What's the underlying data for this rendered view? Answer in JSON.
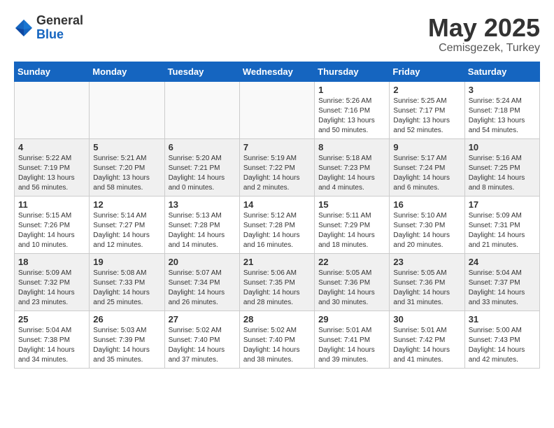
{
  "header": {
    "logo_general": "General",
    "logo_blue": "Blue",
    "month_title": "May 2025",
    "location": "Cemisgezek, Turkey"
  },
  "days_of_week": [
    "Sunday",
    "Monday",
    "Tuesday",
    "Wednesday",
    "Thursday",
    "Friday",
    "Saturday"
  ],
  "weeks": [
    [
      {
        "day": "",
        "info": ""
      },
      {
        "day": "",
        "info": ""
      },
      {
        "day": "",
        "info": ""
      },
      {
        "day": "",
        "info": ""
      },
      {
        "day": "1",
        "info": "Sunrise: 5:26 AM\nSunset: 7:16 PM\nDaylight: 13 hours\nand 50 minutes."
      },
      {
        "day": "2",
        "info": "Sunrise: 5:25 AM\nSunset: 7:17 PM\nDaylight: 13 hours\nand 52 minutes."
      },
      {
        "day": "3",
        "info": "Sunrise: 5:24 AM\nSunset: 7:18 PM\nDaylight: 13 hours\nand 54 minutes."
      }
    ],
    [
      {
        "day": "4",
        "info": "Sunrise: 5:22 AM\nSunset: 7:19 PM\nDaylight: 13 hours\nand 56 minutes."
      },
      {
        "day": "5",
        "info": "Sunrise: 5:21 AM\nSunset: 7:20 PM\nDaylight: 13 hours\nand 58 minutes."
      },
      {
        "day": "6",
        "info": "Sunrise: 5:20 AM\nSunset: 7:21 PM\nDaylight: 14 hours\nand 0 minutes."
      },
      {
        "day": "7",
        "info": "Sunrise: 5:19 AM\nSunset: 7:22 PM\nDaylight: 14 hours\nand 2 minutes."
      },
      {
        "day": "8",
        "info": "Sunrise: 5:18 AM\nSunset: 7:23 PM\nDaylight: 14 hours\nand 4 minutes."
      },
      {
        "day": "9",
        "info": "Sunrise: 5:17 AM\nSunset: 7:24 PM\nDaylight: 14 hours\nand 6 minutes."
      },
      {
        "day": "10",
        "info": "Sunrise: 5:16 AM\nSunset: 7:25 PM\nDaylight: 14 hours\nand 8 minutes."
      }
    ],
    [
      {
        "day": "11",
        "info": "Sunrise: 5:15 AM\nSunset: 7:26 PM\nDaylight: 14 hours\nand 10 minutes."
      },
      {
        "day": "12",
        "info": "Sunrise: 5:14 AM\nSunset: 7:27 PM\nDaylight: 14 hours\nand 12 minutes."
      },
      {
        "day": "13",
        "info": "Sunrise: 5:13 AM\nSunset: 7:28 PM\nDaylight: 14 hours\nand 14 minutes."
      },
      {
        "day": "14",
        "info": "Sunrise: 5:12 AM\nSunset: 7:28 PM\nDaylight: 14 hours\nand 16 minutes."
      },
      {
        "day": "15",
        "info": "Sunrise: 5:11 AM\nSunset: 7:29 PM\nDaylight: 14 hours\nand 18 minutes."
      },
      {
        "day": "16",
        "info": "Sunrise: 5:10 AM\nSunset: 7:30 PM\nDaylight: 14 hours\nand 20 minutes."
      },
      {
        "day": "17",
        "info": "Sunrise: 5:09 AM\nSunset: 7:31 PM\nDaylight: 14 hours\nand 21 minutes."
      }
    ],
    [
      {
        "day": "18",
        "info": "Sunrise: 5:09 AM\nSunset: 7:32 PM\nDaylight: 14 hours\nand 23 minutes."
      },
      {
        "day": "19",
        "info": "Sunrise: 5:08 AM\nSunset: 7:33 PM\nDaylight: 14 hours\nand 25 minutes."
      },
      {
        "day": "20",
        "info": "Sunrise: 5:07 AM\nSunset: 7:34 PM\nDaylight: 14 hours\nand 26 minutes."
      },
      {
        "day": "21",
        "info": "Sunrise: 5:06 AM\nSunset: 7:35 PM\nDaylight: 14 hours\nand 28 minutes."
      },
      {
        "day": "22",
        "info": "Sunrise: 5:05 AM\nSunset: 7:36 PM\nDaylight: 14 hours\nand 30 minutes."
      },
      {
        "day": "23",
        "info": "Sunrise: 5:05 AM\nSunset: 7:36 PM\nDaylight: 14 hours\nand 31 minutes."
      },
      {
        "day": "24",
        "info": "Sunrise: 5:04 AM\nSunset: 7:37 PM\nDaylight: 14 hours\nand 33 minutes."
      }
    ],
    [
      {
        "day": "25",
        "info": "Sunrise: 5:04 AM\nSunset: 7:38 PM\nDaylight: 14 hours\nand 34 minutes."
      },
      {
        "day": "26",
        "info": "Sunrise: 5:03 AM\nSunset: 7:39 PM\nDaylight: 14 hours\nand 35 minutes."
      },
      {
        "day": "27",
        "info": "Sunrise: 5:02 AM\nSunset: 7:40 PM\nDaylight: 14 hours\nand 37 minutes."
      },
      {
        "day": "28",
        "info": "Sunrise: 5:02 AM\nSunset: 7:40 PM\nDaylight: 14 hours\nand 38 minutes."
      },
      {
        "day": "29",
        "info": "Sunrise: 5:01 AM\nSunset: 7:41 PM\nDaylight: 14 hours\nand 39 minutes."
      },
      {
        "day": "30",
        "info": "Sunrise: 5:01 AM\nSunset: 7:42 PM\nDaylight: 14 hours\nand 41 minutes."
      },
      {
        "day": "31",
        "info": "Sunrise: 5:00 AM\nSunset: 7:43 PM\nDaylight: 14 hours\nand 42 minutes."
      }
    ]
  ]
}
